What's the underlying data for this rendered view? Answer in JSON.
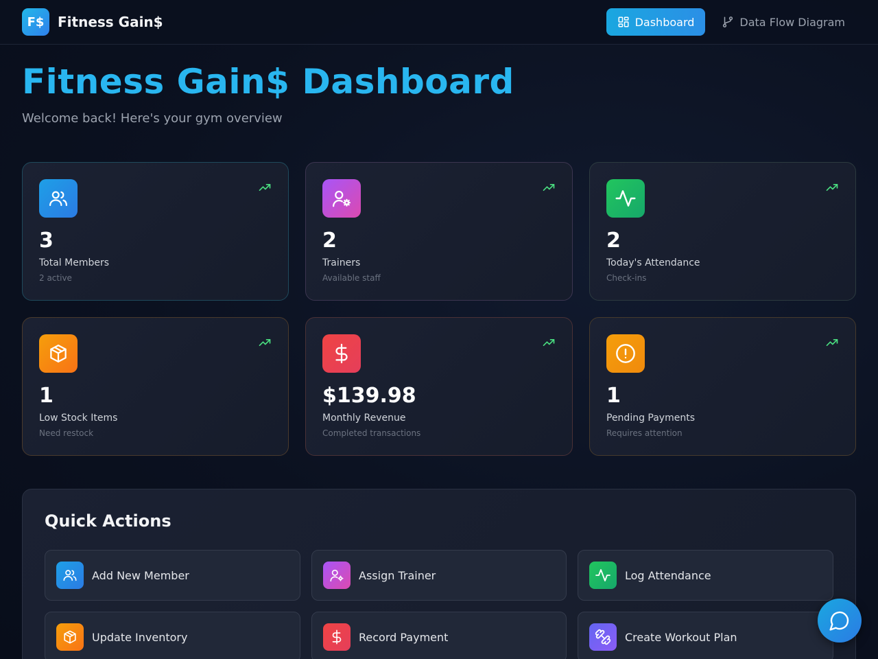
{
  "brand": {
    "logo_text": "F$",
    "name": "Fitness Gain$"
  },
  "nav": {
    "dashboard_label": "Dashboard",
    "diagram_label": "Data Flow Diagram"
  },
  "header": {
    "title": "Fitness Gain$ Dashboard",
    "subtitle": "Welcome back! Here's your gym overview"
  },
  "stats": [
    {
      "value": "3",
      "label": "Total Members",
      "sub": "2 active",
      "icon": "users-icon"
    },
    {
      "value": "2",
      "label": "Trainers",
      "sub": "Available staff",
      "icon": "user-cog-icon"
    },
    {
      "value": "2",
      "label": "Today's Attendance",
      "sub": "Check-ins",
      "icon": "activity-icon"
    },
    {
      "value": "1",
      "label": "Low Stock Items",
      "sub": "Need restock",
      "icon": "package-icon"
    },
    {
      "value": "$139.98",
      "label": "Monthly Revenue",
      "sub": "Completed transactions",
      "icon": "dollar-icon"
    },
    {
      "value": "1",
      "label": "Pending Payments",
      "sub": "Requires attention",
      "icon": "alert-circle-icon"
    }
  ],
  "quick_actions": {
    "title": "Quick Actions",
    "items": [
      {
        "label": "Add New Member",
        "icon": "users-icon"
      },
      {
        "label": "Assign Trainer",
        "icon": "user-cog-icon"
      },
      {
        "label": "Log Attendance",
        "icon": "activity-icon"
      },
      {
        "label": "Update Inventory",
        "icon": "package-icon"
      },
      {
        "label": "Record Payment",
        "icon": "dollar-icon"
      },
      {
        "label": "Create Workout Plan",
        "icon": "dumbbell-icon"
      }
    ]
  },
  "colors": {
    "accent": "#29b6f0",
    "trend": "#4ade80"
  }
}
